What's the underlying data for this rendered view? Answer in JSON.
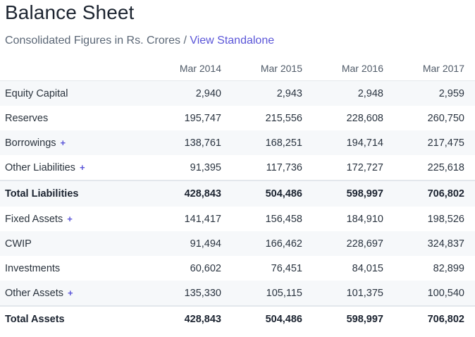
{
  "header": {
    "title": "Balance Sheet",
    "subtitle_text": "Consolidated Figures in Rs. Crores / ",
    "link_label": "View Standalone"
  },
  "columns": [
    "Mar 2014",
    "Mar 2015",
    "Mar 2016",
    "Mar 2017"
  ],
  "expand_symbol": "+",
  "rows": [
    {
      "label": "Equity Capital",
      "values": [
        "2,940",
        "2,943",
        "2,948",
        "2,959"
      ]
    },
    {
      "label": "Reserves",
      "values": [
        "195,747",
        "215,556",
        "228,608",
        "260,750"
      ]
    },
    {
      "label": "Borrowings",
      "values": [
        "138,761",
        "168,251",
        "194,714",
        "217,475"
      ]
    },
    {
      "label": "Other Liabilities",
      "values": [
        "91,395",
        "117,736",
        "172,727",
        "225,618"
      ]
    },
    {
      "label": "Total Liabilities",
      "values": [
        "428,843",
        "504,486",
        "598,997",
        "706,802"
      ]
    },
    {
      "label": "Fixed Assets",
      "values": [
        "141,417",
        "156,458",
        "184,910",
        "198,526"
      ]
    },
    {
      "label": "CWIP",
      "values": [
        "91,494",
        "166,462",
        "228,697",
        "324,837"
      ]
    },
    {
      "label": "Investments",
      "values": [
        "60,602",
        "76,451",
        "84,015",
        "82,899"
      ]
    },
    {
      "label": "Other Assets",
      "values": [
        "135,330",
        "105,115",
        "101,375",
        "100,540"
      ]
    },
    {
      "label": "Total Assets",
      "values": [
        "428,843",
        "504,486",
        "598,997",
        "706,802"
      ]
    }
  ],
  "colors": {
    "accent": "#5a55d8",
    "row_shade": "#f6f8fa"
  }
}
